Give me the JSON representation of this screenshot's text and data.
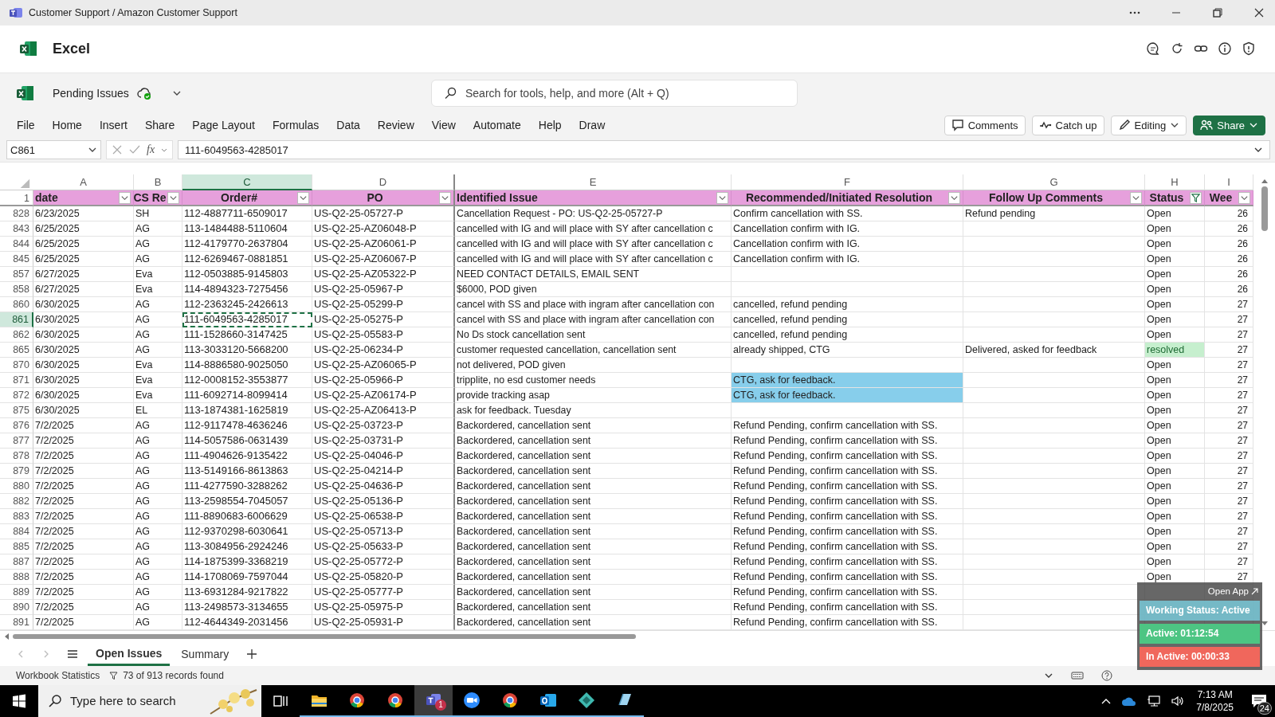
{
  "window": {
    "title": "Customer Support / Amazon Customer Support"
  },
  "app": {
    "name": "Excel"
  },
  "workbook": {
    "name": "Pending Issues",
    "search_placeholder": "Search for tools, help, and more (Alt + Q)"
  },
  "menu": [
    {
      "label": "File",
      "selected": false
    },
    {
      "label": "Home",
      "selected": false
    },
    {
      "label": "Insert",
      "selected": false
    },
    {
      "label": "Share",
      "selected": false
    },
    {
      "label": "Page Layout",
      "selected": false
    },
    {
      "label": "Formulas",
      "selected": false
    },
    {
      "label": "Data",
      "selected": false
    },
    {
      "label": "Review",
      "selected": false
    },
    {
      "label": "View",
      "selected": false
    },
    {
      "label": "Automate",
      "selected": false
    },
    {
      "label": "Help",
      "selected": false
    },
    {
      "label": "Draw",
      "selected": false
    }
  ],
  "buttons": [
    {
      "kind": "comments",
      "label": "Comments"
    },
    {
      "kind": "catchup",
      "label": "Catch up"
    },
    {
      "kind": "editing",
      "label": "Editing"
    },
    {
      "kind": "share",
      "label": "Share"
    }
  ],
  "formula_bar": {
    "cell": "C861",
    "function_label": "fx",
    "value": "111-6049563-4285017"
  },
  "columns": [
    {
      "letter": "A",
      "heading": "date",
      "selected": false,
      "filtered": false
    },
    {
      "letter": "B",
      "heading": "CS Re",
      "selected": false,
      "filtered": false
    },
    {
      "letter": "C",
      "heading": "Order#",
      "selected": true,
      "filtered": false
    },
    {
      "letter": "D",
      "heading": "PO",
      "selected": false,
      "filtered": false
    },
    {
      "letter": "E",
      "heading": "Identified Issue",
      "selected": false,
      "filtered": false
    },
    {
      "letter": "F",
      "heading": "Recommended/Initiated Resolution",
      "selected": false,
      "filtered": false
    },
    {
      "letter": "G",
      "heading": "Follow Up Comments",
      "selected": false,
      "filtered": false
    },
    {
      "letter": "H",
      "heading": "Status",
      "selected": false,
      "filtered": true
    },
    {
      "letter": "I",
      "heading": "Wee",
      "selected": false,
      "filtered": false
    }
  ],
  "header_row": "1",
  "rows": [
    {
      "num": "828",
      "selected": false,
      "date": "6/23/2025",
      "rep": "SH",
      "order": "112-4887711-6509017",
      "po": "US-Q2-25-05727-P",
      "issue": "Cancellation Request - PO: US-Q2-25-05727-P",
      "resolution": "Confirm cancellation with SS.",
      "follow_up": "Refund pending",
      "status": "Open",
      "week": "26"
    },
    {
      "num": "843",
      "selected": false,
      "date": "6/25/2025",
      "rep": "AG",
      "order": "113-1484488-5110604",
      "po": "US-Q2-25-AZ06048-P",
      "issue": "cancelled with IG and will place with SY after cancellation c",
      "resolution": "Cancellation confirm with IG.",
      "status": "Open",
      "week": "26"
    },
    {
      "num": "844",
      "selected": false,
      "date": "6/25/2025",
      "rep": "AG",
      "order": "112-4179770-2637804",
      "po": "US-Q2-25-AZ06061-P",
      "issue": "cancelled with IG and will place with SY after cancellation c",
      "resolution": "Cancellation confirm with IG.",
      "status": "Open",
      "week": "26"
    },
    {
      "num": "845",
      "selected": false,
      "date": "6/25/2025",
      "rep": "AG",
      "order": "112-6269467-0881851",
      "po": "US-Q2-25-AZ06067-P",
      "issue": "cancelled with IG and will place with SY after cancellation c",
      "resolution": "Cancellation confirm with IG.",
      "status": "Open",
      "week": "26"
    },
    {
      "num": "857",
      "selected": false,
      "date": "6/27/2025",
      "rep": "Eva",
      "order": "112-0503885-9145803",
      "po": "US-Q2-25-AZ05322-P",
      "issue": "NEED CONTACT DETAILS, EMAIL SENT",
      "status": "Open",
      "week": "26"
    },
    {
      "num": "858",
      "selected": false,
      "date": "6/27/2025",
      "rep": "Eva",
      "order": "114-4894323-7275456",
      "po": "US-Q2-25-05967-P",
      "issue": "$6000, POD given",
      "status": "Open",
      "week": "26"
    },
    {
      "num": "860",
      "selected": false,
      "date": "6/30/2025",
      "rep": "AG",
      "order": "112-2363245-2426613",
      "po": "US-Q2-25-05299-P",
      "issue": "cancel with SS and place with ingram after cancellation con",
      "resolution": "cancelled, refund pending",
      "status": "Open",
      "week": "27"
    },
    {
      "num": "861",
      "selected": true,
      "date": "6/30/2025",
      "rep": "AG",
      "order": "111-6049563-4285017",
      "po": "US-Q2-25-05275-P",
      "issue": "cancel with SS and place with ingram after cancellation con",
      "resolution": "cancelled, refund pending",
      "status": "Open",
      "week": "27"
    },
    {
      "num": "862",
      "selected": false,
      "date": "6/30/2025",
      "rep": "AG",
      "order": "111-1528660-3147425",
      "po": "US-Q2-25-05583-P",
      "issue": "No Ds stock cancellation sent",
      "resolution": "cancelled, refund pending",
      "status": "Open",
      "week": "27"
    },
    {
      "num": "865",
      "selected": false,
      "date": "6/30/2025",
      "rep": "AG",
      "order": "113-3033120-5668200",
      "po": "US-Q2-25-06234-P",
      "issue": "customer requested cancellation, cancellation sent",
      "resolution": "already shipped, CTG",
      "follow_up": "Delivered, asked for feedback",
      "status": {
        "text": "resolved",
        "color": "#c6efce"
      },
      "week": "27"
    },
    {
      "num": "870",
      "selected": false,
      "date": "6/30/2025",
      "rep": "Eva",
      "order": "114-8886580-9025050",
      "po": "US-Q2-25-AZ06065-P",
      "issue": "not delivered, POD given",
      "status": "Open",
      "week": "27"
    },
    {
      "num": "871",
      "selected": false,
      "date": "6/30/2025",
      "rep": "Eva",
      "order": "112-0008152-3553877",
      "po": "US-Q2-25-05966-P",
      "issue": "tripplite, no esd customer needs",
      "resolution": {
        "text": "CTG, ask for feedback.",
        "color": "#87ceeb"
      },
      "status": "Open",
      "week": "27"
    },
    {
      "num": "872",
      "selected": false,
      "date": "6/30/2025",
      "rep": "Eva",
      "order": "111-6092714-8099414",
      "po": "US-Q2-25-AZ06174-P",
      "issue": "provide tracking asap",
      "resolution": {
        "text": "CTG, ask for feedback.",
        "color": "#87ceeb"
      },
      "status": "Open",
      "week": "27"
    },
    {
      "num": "875",
      "selected": false,
      "date": "6/30/2025",
      "rep": "EL",
      "order": "113-1874381-1625819",
      "po": "US-Q2-25-AZ06413-P",
      "issue": "ask for feedback. Tuesday",
      "status": "Open",
      "week": "27"
    },
    {
      "num": "876",
      "selected": false,
      "date": "7/2/2025",
      "rep": "AG",
      "order": "112-9117478-4636246",
      "po": "US-Q2-25-03723-P",
      "issue": "Backordered, cancellation sent",
      "resolution": "Refund Pending, confirm cancellation with SS.",
      "status": "Open",
      "week": "27"
    },
    {
      "num": "877",
      "selected": false,
      "date": "7/2/2025",
      "rep": "AG",
      "order": "114-5057586-0631439",
      "po": "US-Q2-25-03731-P",
      "issue": "Backordered, cancellation sent",
      "resolution": "Refund Pending, confirm cancellation with SS.",
      "status": "Open",
      "week": "27"
    },
    {
      "num": "878",
      "selected": false,
      "date": "7/2/2025",
      "rep": "AG",
      "order": "111-4904626-9135422",
      "po": "US-Q2-25-04046-P",
      "issue": "Backordered, cancellation sent",
      "resolution": "Refund Pending, confirm cancellation with SS.",
      "status": "Open",
      "week": "27"
    },
    {
      "num": "879",
      "selected": false,
      "date": "7/2/2025",
      "rep": "AG",
      "order": "113-5149166-8613863",
      "po": "US-Q2-25-04214-P",
      "issue": "Backordered, cancellation sent",
      "resolution": "Refund Pending, confirm cancellation with SS.",
      "status": "Open",
      "week": "27"
    },
    {
      "num": "880",
      "selected": false,
      "date": "7/2/2025",
      "rep": "AG",
      "order": "111-4277590-3288262",
      "po": "US-Q2-25-04636-P",
      "issue": "Backordered, cancellation sent",
      "resolution": "Refund Pending, confirm cancellation with SS.",
      "status": "Open",
      "week": "27"
    },
    {
      "num": "882",
      "selected": false,
      "date": "7/2/2025",
      "rep": "AG",
      "order": "113-2598554-7045057",
      "po": "US-Q2-25-05136-P",
      "issue": "Backordered, cancellation sent",
      "resolution": "Refund Pending, confirm cancellation with SS.",
      "status": "Open",
      "week": "27"
    },
    {
      "num": "883",
      "selected": false,
      "date": "7/2/2025",
      "rep": "AG",
      "order": "111-8890683-6006629",
      "po": "US-Q2-25-06538-P",
      "issue": "Backordered, cancellation sent",
      "resolution": "Refund Pending, confirm cancellation with SS.",
      "status": "Open",
      "week": "27"
    },
    {
      "num": "884",
      "selected": false,
      "date": "7/2/2025",
      "rep": "AG",
      "order": "112-9370298-6030641",
      "po": "US-Q2-25-05713-P",
      "issue": "Backordered, cancellation sent",
      "resolution": "Refund Pending, confirm cancellation with SS.",
      "status": "Open",
      "week": "27"
    },
    {
      "num": "885",
      "selected": false,
      "date": "7/2/2025",
      "rep": "AG",
      "order": "113-3084956-2924246",
      "po": "US-Q2-25-05633-P",
      "issue": "Backordered, cancellation sent",
      "resolution": "Refund Pending, confirm cancellation with SS.",
      "status": "Open",
      "week": "27"
    },
    {
      "num": "887",
      "selected": false,
      "date": "7/2/2025",
      "rep": "AG",
      "order": "114-1875399-3368219",
      "po": "US-Q2-25-05772-P",
      "issue": "Backordered, cancellation sent",
      "resolution": "Refund Pending, confirm cancellation with SS.",
      "status": "Open",
      "week": "27"
    },
    {
      "num": "888",
      "selected": false,
      "date": "7/2/2025",
      "rep": "AG",
      "order": "114-1708069-7597044",
      "po": "US-Q2-25-05820-P",
      "issue": "Backordered, cancellation sent",
      "resolution": "Refund Pending, confirm cancellation with SS.",
      "status": "Open",
      "week": "27"
    },
    {
      "num": "889",
      "selected": false,
      "date": "7/2/2025",
      "rep": "AG",
      "order": "113-6931284-9217822",
      "po": "US-Q2-25-05777-P",
      "issue": "Backordered, cancellation sent",
      "resolution": "Refund Pending, confirm cancellation with SS."
    },
    {
      "num": "890",
      "selected": false,
      "date": "7/2/2025",
      "rep": "AG",
      "order": "113-2498573-3134655",
      "po": "US-Q2-25-05975-P",
      "issue": "Backordered, cancellation sent",
      "resolution": "Refund Pending, confirm cancellation with SS."
    },
    {
      "num": "891",
      "selected": false,
      "date": "7/2/2025",
      "rep": "AG",
      "order": "112-4644349-2031456",
      "po": "US-Q2-25-05931-P",
      "issue": "Backordered, cancellation sent",
      "resolution": "Refund Pending, confirm cancellation with SS."
    }
  ],
  "sheets": [
    {
      "label": "Open Issues",
      "selected": true
    },
    {
      "label": "Summary",
      "selected": false
    }
  ],
  "status_bar": {
    "statistics": "Workbook Statistics",
    "records": "73 of 913 records found"
  },
  "tracker": {
    "button": "Open App",
    "status": "Working Status: Active",
    "active": "Active: 01:12:54",
    "inactive": "In Active: 00:00:33"
  },
  "taskbar": {
    "search_placeholder": "Type here to search",
    "apps": [
      {
        "kind": "taskview",
        "selected": false
      },
      {
        "kind": "folder",
        "selected": false
      },
      {
        "kind": "browser",
        "selected": false
      },
      {
        "kind": "browser",
        "selected": false
      },
      {
        "kind": "chat",
        "selected": true,
        "badge": "1"
      },
      {
        "kind": "video",
        "selected": false
      },
      {
        "kind": "browser",
        "selected": false
      },
      {
        "kind": "mail",
        "selected": false
      },
      {
        "kind": "diamond",
        "selected": false
      },
      {
        "kind": "notes",
        "selected": false
      }
    ],
    "time": "7:13 AM",
    "date": "7/8/2025",
    "notifications": "24"
  }
}
